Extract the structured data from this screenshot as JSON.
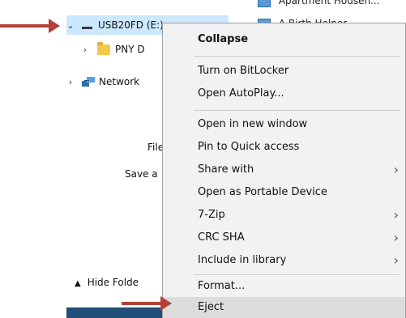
{
  "nav": {
    "usb_drive_label": "USB20FD (E:)",
    "pny_folder_label": "PNY D",
    "network_label": "Network",
    "hide_folders_label": "Hide Folde"
  },
  "dialog": {
    "file_label": "File",
    "save_label": "Save a",
    "a_label": "A"
  },
  "file_list": {
    "top_item_1": "Apartment Househ...",
    "top_item_2": "A Birth Helper..."
  },
  "context_menu": {
    "items": [
      {
        "label": "Collapse"
      },
      {
        "label": "Turn on BitLocker"
      },
      {
        "label": "Open AutoPlay..."
      },
      {
        "label": "Open in new window"
      },
      {
        "label": "Pin to Quick access"
      },
      {
        "label": "Share with"
      },
      {
        "label": "Open as Portable Device"
      },
      {
        "label": "7-Zip"
      },
      {
        "label": "CRC SHA"
      },
      {
        "label": "Include in library"
      },
      {
        "label": "Format..."
      },
      {
        "label": "Eject"
      }
    ]
  },
  "icons": {
    "drive": "usb-drive-icon",
    "folder": "folder-icon",
    "network": "network-icon",
    "submenu": "chevron-right-icon"
  },
  "colors": {
    "selection_highlight": "#cce8ff",
    "menu_background": "#f2f2f2",
    "menu_hover": "#dcdcdc",
    "annotation_arrow": "#b3413a"
  }
}
